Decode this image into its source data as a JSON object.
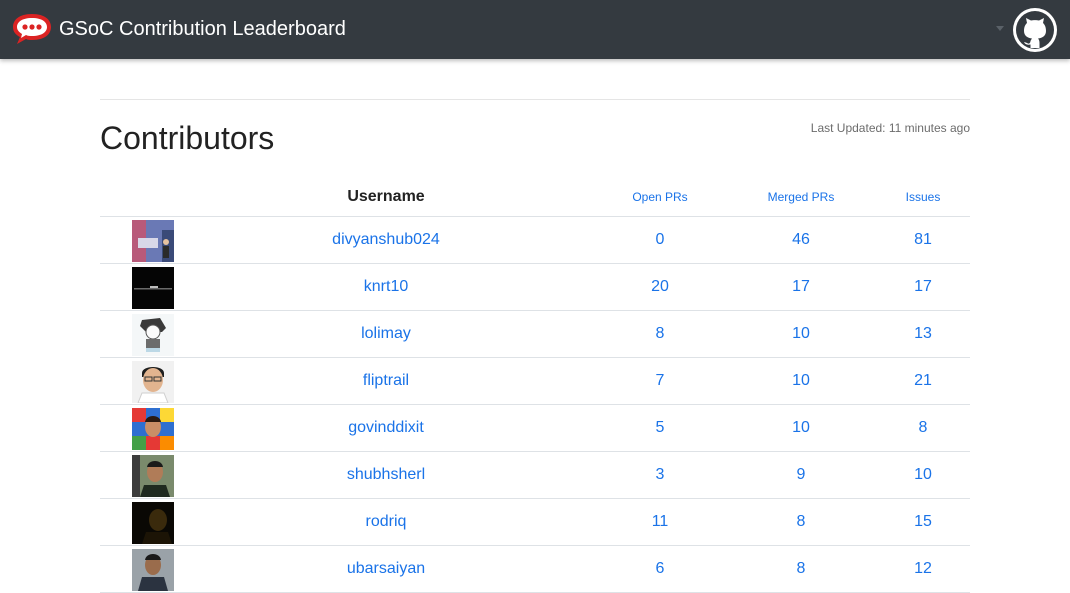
{
  "app": {
    "title": "GSoC Contribution Leaderboard"
  },
  "icons": {
    "logo": "rocket-chat-logo-icon",
    "github": "github-icon",
    "caret": "caret-down-icon"
  },
  "colors": {
    "navbar": "#343a40",
    "link": "#1a73e8",
    "logo": "#db2323"
  },
  "page": {
    "title": "Contributors",
    "last_updated": "Last Updated: 11 minutes ago"
  },
  "table": {
    "headers": {
      "username": "Username",
      "open_prs": "Open PRs",
      "merged_prs": "Merged PRs",
      "issues": "Issues"
    },
    "rows": [
      {
        "username": "divyanshub024",
        "open_prs": "0",
        "merged_prs": "46",
        "issues": "81"
      },
      {
        "username": "knrt10",
        "open_prs": "20",
        "merged_prs": "17",
        "issues": "17"
      },
      {
        "username": "lolimay",
        "open_prs": "8",
        "merged_prs": "10",
        "issues": "13"
      },
      {
        "username": "fliptrail",
        "open_prs": "7",
        "merged_prs": "10",
        "issues": "21"
      },
      {
        "username": "govinddixit",
        "open_prs": "5",
        "merged_prs": "10",
        "issues": "8"
      },
      {
        "username": "shubhsherl",
        "open_prs": "3",
        "merged_prs": "9",
        "issues": "10"
      },
      {
        "username": "rodriq",
        "open_prs": "11",
        "merged_prs": "8",
        "issues": "15"
      },
      {
        "username": "ubarsaiyan",
        "open_prs": "6",
        "merged_prs": "8",
        "issues": "12"
      }
    ]
  }
}
